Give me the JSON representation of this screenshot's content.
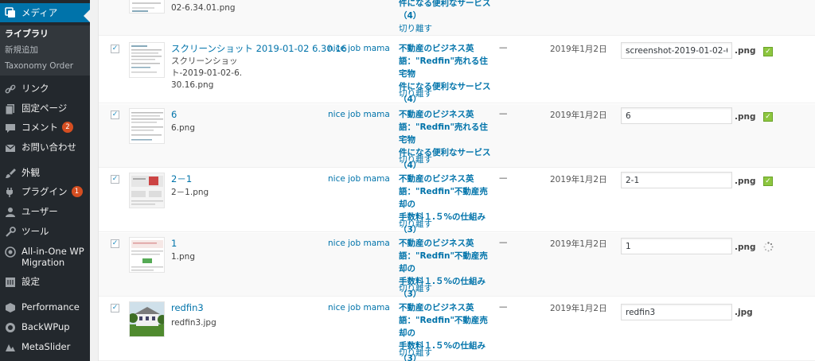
{
  "sidebar": {
    "media": "メディア",
    "library": "ライブラリ",
    "add_new": "新規追加",
    "taxonomy": "Taxonomy Order",
    "links": "リンク",
    "pages": "固定ページ",
    "comments": "コメント",
    "comments_count": "2",
    "contact": "お問い合わせ",
    "appearance": "外観",
    "plugins": "プラグイン",
    "plugins_count": "1",
    "users": "ユーザー",
    "tools": "ツール",
    "aio_line1": "All-in-One WP",
    "aio_line2": "Migration",
    "settings": "設定",
    "performance": "Performance",
    "backwpup": "BackWPup",
    "metaslider": "MetaSlider"
  },
  "rows": [
    {
      "filename": "02-6.34.01.png",
      "attached": [
        "件になる便利なサービス",
        "（4）"
      ],
      "detach": "切り離す"
    },
    {
      "title": "スクリーンショット 2019-01-02 6.30.16",
      "filename": "スクリーンショット-2019-01-02-6.30.16.png",
      "author": "nice job mama",
      "attached": [
        "不動産のビジネス英",
        "語：\"Redfin\"売れる住宅物",
        "件になる便利なサービス",
        "（4）"
      ],
      "detach": "切り離す",
      "dash": "—",
      "date": "2019年1月2日",
      "input": "screenshot-2019-01-02-6.30.16",
      "ext": ".png",
      "status": "ok"
    },
    {
      "title": "6",
      "filename": "6.png",
      "author": "nice job mama",
      "attached": [
        "不動産のビジネス英",
        "語：\"Redfin\"売れる住宅物",
        "件になる便利なサービス",
        "（4）"
      ],
      "detach": "切り離す",
      "dash": "—",
      "date": "2019年1月2日",
      "input": "6",
      "ext": ".png",
      "status": "ok"
    },
    {
      "title": "2－1",
      "filename": "2－1.png",
      "author": "nice job mama",
      "attached": [
        "不動産のビジネス英",
        "語：\"Redfin\"不動産売却の",
        "手数料１.５%の仕組み",
        "（3）"
      ],
      "detach": "切り離す",
      "dash": "—",
      "date": "2019年1月2日",
      "input": "2-1",
      "ext": ".png",
      "status": "ok"
    },
    {
      "title": "1",
      "filename": "1.png",
      "author": "nice job mama",
      "attached": [
        "不動産のビジネス英",
        "語：\"Redfin\"不動産売却の",
        "手数料１.５%の仕組み",
        "（3）"
      ],
      "detach": "切り離す",
      "dash": "—",
      "date": "2019年1月2日",
      "input": "1",
      "ext": ".png",
      "status": "loading"
    },
    {
      "title": "redfin3",
      "filename": "redfin3.jpg",
      "author": "nice job mama",
      "attached": [
        "不動産のビジネス英",
        "語：\"Redfin\"不動産売却の",
        "手数料１.５%の仕組み",
        "（3）"
      ],
      "detach": "切り離す",
      "dash": "—",
      "date": "2019年1月2日",
      "input": "redfin3",
      "ext": ".jpg",
      "status": "none"
    }
  ],
  "colors": {
    "sidebar_bg": "#23282d",
    "accent": "#0073aa",
    "badge": "#d54e21",
    "ok_green": "#8dc63f"
  }
}
